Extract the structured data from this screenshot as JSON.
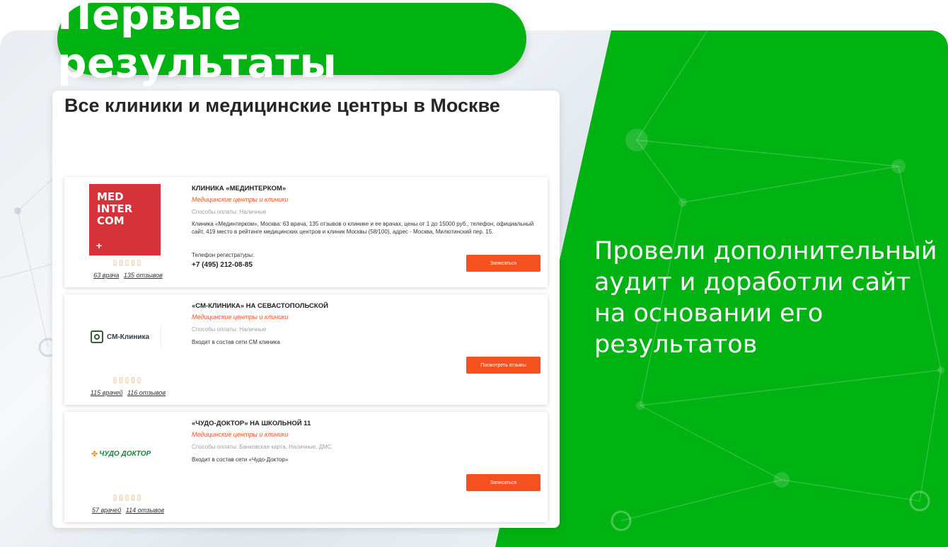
{
  "banner": {
    "title": "Первые результаты"
  },
  "panel": {
    "title": "Все клиники и медицинские центры в Москве"
  },
  "clinics": [
    {
      "logo_text": "MED\nINTER\nCOM",
      "logo_plus": "+",
      "stars": "▯▯▯▯▯",
      "doctors": "63 врача",
      "reviews": "135 отзывов",
      "name": "КЛИНИКА «МЕДИНТЕРКОМ»",
      "category": "Медицинские центры и клиники",
      "payment": "Способы оплаты: Наличные",
      "description": "Клиника «Мединтерком», Москва: 63 врача, 135 отзывов о клинике и ее врачах, цены от 1 до 15000 руб., телефон, официальный сайт, 419 место в рейтинге медицинских центров и клиник Москвы (58/100), адрес - Москва, Милютинский пер. 15.",
      "phone_label": "Телефон регистратуры:",
      "phone": "+7 (495) 212-08-85",
      "button": "Записаться"
    },
    {
      "logo_text": "СМ-Клиника",
      "stars": "▯▯▯▯▯",
      "doctors": "115 врачей",
      "reviews": "116 отзывов",
      "name": "«СМ-КЛИНИКА» НА СЕВАСТОПОЛЬСКОЙ",
      "category": "Медицинские центры и клиники",
      "payment": "Способы оплаты: Наличные",
      "description": "Входит в состав сети СМ клиника",
      "button": "Посмотреть отзывы"
    },
    {
      "logo_text": "ЧУДО ДОКТОР",
      "stars": "▯▯▯▯▯",
      "doctors": "57 врачей",
      "reviews": "114 отзывов",
      "name": "«ЧУДО-ДОКТОР» НА ШКОЛЬНОЙ 11",
      "category": "Медицинские центры и клиники",
      "payment": "Способы оплаты: Банковская карта, Наличные, ДМС",
      "description": "Входит в состав сети «Чудо-Доктор»",
      "button": "Записаться"
    }
  ],
  "side": {
    "text": "Провели дополнительный аудит и доработли сайт на основании его результатов"
  },
  "colors": {
    "brand_green": "#00b212",
    "accent_orange": "#f4511e",
    "logo_red": "#d6323a"
  }
}
